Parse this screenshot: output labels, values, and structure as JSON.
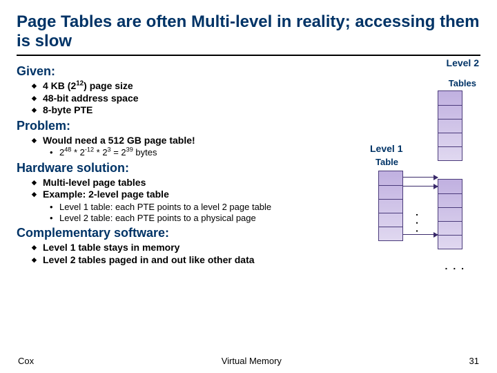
{
  "title": "Page Tables are often Multi-level in reality; accessing them is slow",
  "given": {
    "heading": "Given:",
    "items_html": [
      "4 KB (2<sup>12</sup>) page size",
      "48-bit address space",
      "8-byte PTE"
    ]
  },
  "problem": {
    "heading": "Problem:",
    "items_html": [
      "Would need a 512 GB page table!"
    ],
    "subitems_html": [
      "2<sup>48</sup> * 2<sup>-12</sup> * 2<sup>3</sup> = 2<sup>39</sup> bytes"
    ]
  },
  "hardware": {
    "heading": "Hardware solution:",
    "items": [
      "Multi-level page tables",
      "Example: 2-level page table"
    ],
    "subitems": [
      "Level 1 table: each PTE points to a level 2 page table",
      "Level 2 table: each PTE points to a physical page"
    ]
  },
  "complementary": {
    "heading": "Complementary software:",
    "items": [
      "Level 1 table stays in memory",
      "Level 2 tables paged in and out like other data"
    ]
  },
  "diagram": {
    "level2_label": "Level 2",
    "tables_label": "Tables",
    "level1_label": "Level 1",
    "table_label": "Table",
    "dots_vert": ". . .",
    "dots_horiz": ". . ."
  },
  "footer": {
    "left": "Cox",
    "center": "Virtual Memory",
    "right": "31"
  }
}
